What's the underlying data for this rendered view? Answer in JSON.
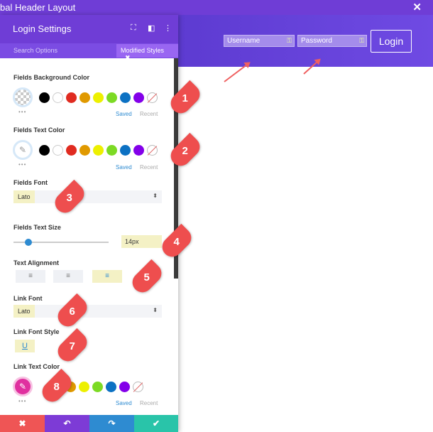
{
  "window": {
    "title": "bal Header Layout",
    "close": "✕"
  },
  "preview": {
    "username_placeholder": "Username",
    "password_placeholder": "Password",
    "login_label": "Login",
    "key_glyph": "⚿"
  },
  "panel": {
    "title": "Login Settings",
    "search_label": "Search Options",
    "modified_label": "Modified Styles",
    "modified_close": "✖"
  },
  "settings": {
    "fields_bg_label": "Fields Background Color",
    "fields_text_color_label": "Fields Text Color",
    "fields_font_label": "Fields Font",
    "fields_font_value": "Lato",
    "fields_text_size_label": "Fields Text Size",
    "fields_text_size_value": "14px",
    "fields_text_size_slider": 0.14,
    "text_alignment_label": "Text Alignment",
    "link_font_label": "Link Font",
    "link_font_value": "Lato",
    "link_font_style_label": "Link Font Style",
    "link_font_style_value": "U",
    "link_text_color_label": "Link Text Color",
    "saved": "Saved",
    "recent": "Recent",
    "more": "•••"
  },
  "swatches": [
    "#000000",
    "#ffffff",
    "#e02b20",
    "#e09900",
    "#edf000",
    "#7cda24",
    "#0c71c3",
    "#8300e9"
  ],
  "accent_colors": {
    "purple": "#6f3dd6",
    "blue": "#2e8bd1",
    "red": "#ef5555",
    "pink": "#e0309f"
  },
  "callouts": [
    "1",
    "2",
    "3",
    "4",
    "5",
    "6",
    "7",
    "8"
  ],
  "footer": {
    "discard": "✖",
    "undo": "↶",
    "redo": "↷",
    "save": "✔"
  }
}
